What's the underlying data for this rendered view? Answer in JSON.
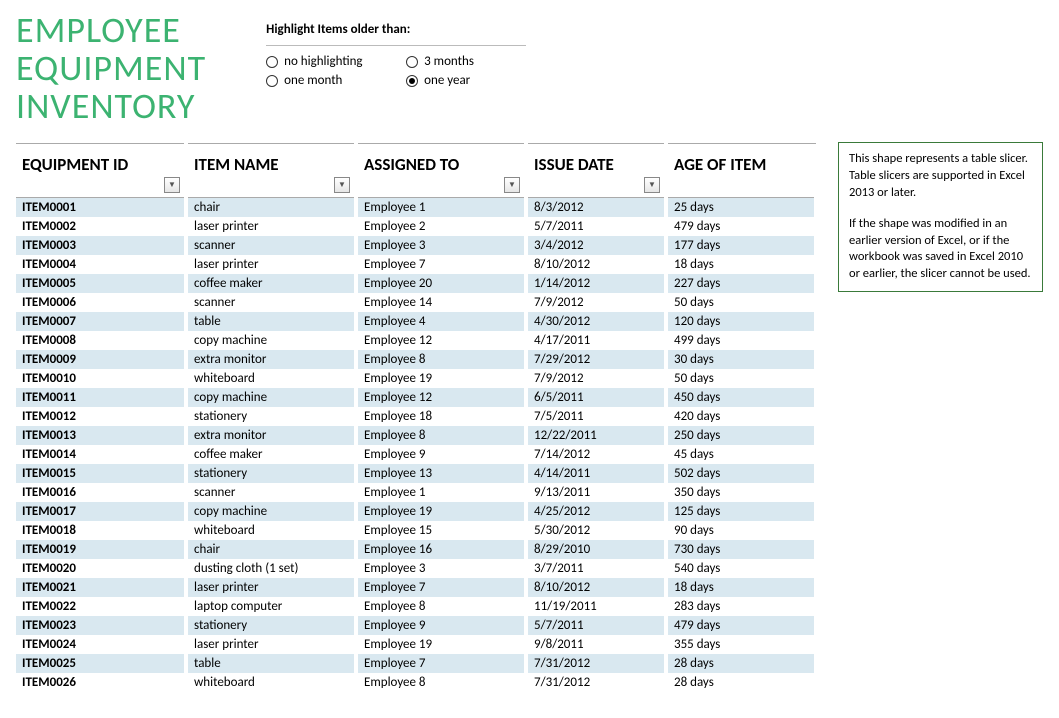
{
  "title_lines": [
    "EMPLOYEE",
    "EQUIPMENT",
    "INVENTORY"
  ],
  "highlight": {
    "label": "Highlight Items older than:",
    "options": [
      {
        "label": "no highlighting",
        "selected": false
      },
      {
        "label": "3 months",
        "selected": false
      },
      {
        "label": "one month",
        "selected": false
      },
      {
        "label": "one year",
        "selected": true
      }
    ]
  },
  "columns": {
    "id": "EQUIPMENT ID",
    "name": "ITEM NAME",
    "assigned": "ASSIGNED TO",
    "date": "ISSUE DATE",
    "age": "AGE OF ITEM"
  },
  "rows": [
    {
      "id": "ITEM0001",
      "name": "chair",
      "assigned": "Employee 1",
      "date": "8/3/2012",
      "age": "25 days"
    },
    {
      "id": "ITEM0002",
      "name": "laser printer",
      "assigned": "Employee 2",
      "date": "5/7/2011",
      "age": "479 days"
    },
    {
      "id": "ITEM0003",
      "name": "scanner",
      "assigned": "Employee 3",
      "date": "3/4/2012",
      "age": "177 days"
    },
    {
      "id": "ITEM0004",
      "name": "laser printer",
      "assigned": "Employee 7",
      "date": "8/10/2012",
      "age": "18 days"
    },
    {
      "id": "ITEM0005",
      "name": "coffee maker",
      "assigned": "Employee 20",
      "date": "1/14/2012",
      "age": "227 days"
    },
    {
      "id": "ITEM0006",
      "name": "scanner",
      "assigned": "Employee 14",
      "date": "7/9/2012",
      "age": "50 days"
    },
    {
      "id": "ITEM0007",
      "name": "table",
      "assigned": "Employee 4",
      "date": "4/30/2012",
      "age": "120 days"
    },
    {
      "id": "ITEM0008",
      "name": "copy machine",
      "assigned": "Employee 12",
      "date": "4/17/2011",
      "age": "499 days"
    },
    {
      "id": "ITEM0009",
      "name": "extra monitor",
      "assigned": "Employee 8",
      "date": "7/29/2012",
      "age": "30 days"
    },
    {
      "id": "ITEM0010",
      "name": "whiteboard",
      "assigned": "Employee 19",
      "date": "7/9/2012",
      "age": "50 days"
    },
    {
      "id": "ITEM0011",
      "name": "copy machine",
      "assigned": "Employee 12",
      "date": "6/5/2011",
      "age": "450 days"
    },
    {
      "id": "ITEM0012",
      "name": "stationery",
      "assigned": "Employee 18",
      "date": "7/5/2011",
      "age": "420 days"
    },
    {
      "id": "ITEM0013",
      "name": "extra monitor",
      "assigned": "Employee 8",
      "date": "12/22/2011",
      "age": "250 days"
    },
    {
      "id": "ITEM0014",
      "name": "coffee maker",
      "assigned": "Employee 9",
      "date": "7/14/2012",
      "age": "45 days"
    },
    {
      "id": "ITEM0015",
      "name": "stationery",
      "assigned": "Employee 13",
      "date": "4/14/2011",
      "age": "502 days"
    },
    {
      "id": "ITEM0016",
      "name": "scanner",
      "assigned": "Employee 1",
      "date": "9/13/2011",
      "age": "350 days"
    },
    {
      "id": "ITEM0017",
      "name": "copy machine",
      "assigned": "Employee 19",
      "date": "4/25/2012",
      "age": "125 days"
    },
    {
      "id": "ITEM0018",
      "name": "whiteboard",
      "assigned": "Employee 15",
      "date": "5/30/2012",
      "age": "90 days"
    },
    {
      "id": "ITEM0019",
      "name": "chair",
      "assigned": "Employee 16",
      "date": "8/29/2010",
      "age": "730 days"
    },
    {
      "id": "ITEM0020",
      "name": "dusting cloth (1 set)",
      "assigned": "Employee 3",
      "date": "3/7/2011",
      "age": "540 days"
    },
    {
      "id": "ITEM0021",
      "name": "laser printer",
      "assigned": "Employee 7",
      "date": "8/10/2012",
      "age": "18 days"
    },
    {
      "id": "ITEM0022",
      "name": "laptop computer",
      "assigned": "Employee 8",
      "date": "11/19/2011",
      "age": "283 days"
    },
    {
      "id": "ITEM0023",
      "name": "stationery",
      "assigned": "Employee 9",
      "date": "5/7/2011",
      "age": "479 days"
    },
    {
      "id": "ITEM0024",
      "name": "laser printer",
      "assigned": "Employee 19",
      "date": "9/8/2011",
      "age": "355 days"
    },
    {
      "id": "ITEM0025",
      "name": "table",
      "assigned": "Employee 7",
      "date": "7/31/2012",
      "age": "28 days"
    },
    {
      "id": "ITEM0026",
      "name": "whiteboard",
      "assigned": "Employee 8",
      "date": "7/31/2012",
      "age": "28 days"
    }
  ],
  "slicer": {
    "p1": "This shape represents a table slicer. Table slicers are supported in Excel 2013 or later.",
    "p2": "If the shape was modified in an earlier version of Excel, or if the workbook was saved in Excel 2010 or earlier, the slicer cannot be used."
  }
}
